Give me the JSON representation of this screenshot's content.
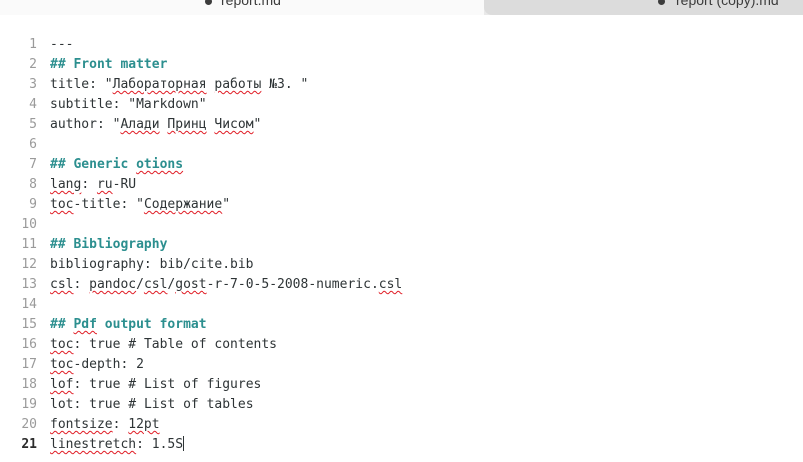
{
  "tabs": [
    {
      "label": "report.md",
      "active": true
    },
    {
      "label": "report (copy).md",
      "active": false
    }
  ],
  "editor": {
    "current_line": 21,
    "lines": [
      {
        "n": "1",
        "t": "---"
      },
      {
        "n": "2",
        "t": "## Front matter",
        "h": true
      },
      {
        "n": "3",
        "t": "title: \"Лабораторная работы №3. \""
      },
      {
        "n": "4",
        "t": "subtitle: \"Markdown\""
      },
      {
        "n": "5",
        "t": "author: \"Алади Принц Чисом\""
      },
      {
        "n": "6",
        "t": ""
      },
      {
        "n": "7",
        "t": "## Generic otions",
        "h": true
      },
      {
        "n": "8",
        "t": "lang: ru-RU"
      },
      {
        "n": "9",
        "t": "toc-title: \"Содержание\""
      },
      {
        "n": "10",
        "t": ""
      },
      {
        "n": "11",
        "t": "## Bibliography",
        "h": true
      },
      {
        "n": "12",
        "t": "bibliography: bib/cite.bib"
      },
      {
        "n": "13",
        "t": "csl: pandoc/csl/gost-r-7-0-5-2008-numeric.csl"
      },
      {
        "n": "14",
        "t": ""
      },
      {
        "n": "15",
        "t": "## Pdf output format",
        "h": true
      },
      {
        "n": "16",
        "t": "toc: true # Table of contents"
      },
      {
        "n": "17",
        "t": "toc-depth: 2"
      },
      {
        "n": "18",
        "t": "lof: true # List of figures"
      },
      {
        "n": "19",
        "t": "lot: true # List of tables"
      },
      {
        "n": "20",
        "t": "fontsize: 12pt"
      },
      {
        "n": "21",
        "t": "linestretch: 1.5S"
      }
    ]
  },
  "spell_errors": [
    "Лабораторная",
    "работы",
    "Алади",
    "Принц",
    "Чисом",
    "otions",
    "lang",
    "ru",
    "toc",
    "Содержание",
    "csl",
    "pandoc",
    "gost",
    "Pdf",
    "lof",
    "fontsize",
    "12pt",
    "linestretch"
  ],
  "colors": {
    "heading": "#2c8f8f",
    "text": "#2e3436",
    "line_number": "#9a9a9a",
    "spell_underline": "#e01b24",
    "tabbar": "#e9e9e9"
  }
}
